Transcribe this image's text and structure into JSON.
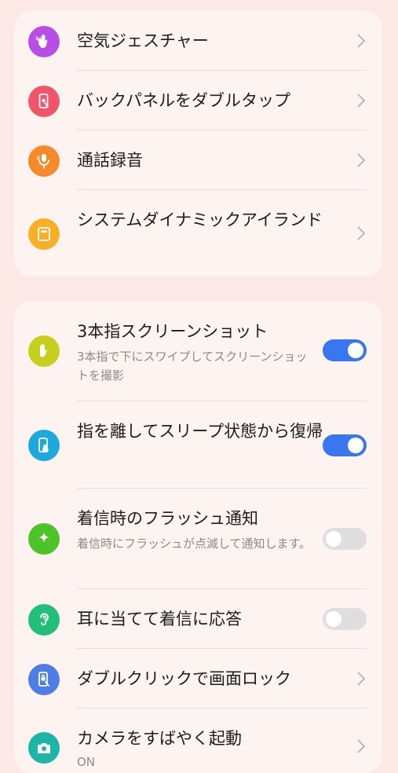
{
  "colors": {
    "background": "#fce9e6",
    "card": "#fdf4f2",
    "toggle_on": "#3877f0",
    "toggle_off": "#dedede"
  },
  "group1": {
    "items": [
      {
        "title": "空気ジェスチャー",
        "icon": "air-gesture-icon",
        "icon_color": "#b84ee6",
        "control": "chevron"
      },
      {
        "title": "バックパネルをダブルタップ",
        "icon": "back-tap-icon",
        "icon_color": "#f0556a",
        "control": "chevron"
      },
      {
        "title": "通話録音",
        "icon": "microphone-icon",
        "icon_color": "#f58a2b",
        "control": "chevron"
      },
      {
        "title": "システムダイナミックアイランド",
        "icon": "dynamic-island-icon",
        "icon_color": "#f7b026",
        "control": "chevron"
      }
    ]
  },
  "group2": {
    "items": [
      {
        "title": "3本指スクリーンショット",
        "subtitle": "3本指で下にスワイプしてスクリーンショットを撮影",
        "icon": "three-finger-icon",
        "icon_color": "#c6cf1c",
        "control": "toggle",
        "state": "on"
      },
      {
        "title": "指を離してスリープ状態から復帰",
        "icon": "phone-wake-icon",
        "icon_color": "#1ea9dc",
        "control": "toggle",
        "state": "on"
      },
      {
        "title": "着信時のフラッシュ通知",
        "subtitle": "着信時にフラッシュが点滅して通知します。",
        "icon": "sparkle-icon",
        "icon_color": "#4cc427",
        "control": "toggle",
        "state": "off"
      },
      {
        "title": "耳に当てて着信に応答",
        "icon": "ear-icon",
        "icon_color": "#21bf78",
        "control": "toggle",
        "state": "off"
      },
      {
        "title": "ダブルクリックで画面ロック",
        "icon": "lock-tap-icon",
        "icon_color": "#4e7de6",
        "control": "chevron"
      },
      {
        "title": "カメラをすばやく起動",
        "subtitle": "ON",
        "icon": "camera-icon",
        "icon_color": "#1cb5a8",
        "control": "chevron"
      }
    ]
  }
}
